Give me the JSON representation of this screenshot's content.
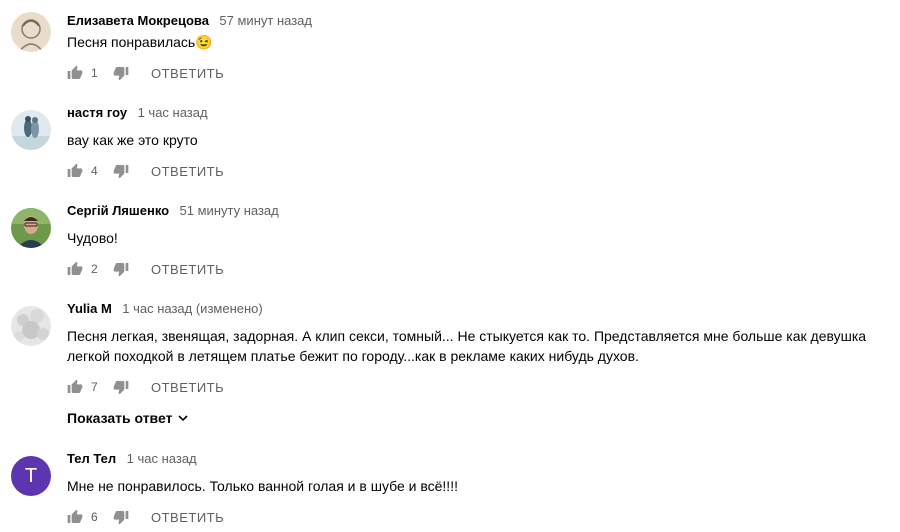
{
  "comments": [
    {
      "author": "Елизавета Мокрецова",
      "time": "57 минут назад",
      "text": "Песня понравилась😉",
      "likes": "1",
      "reply_label": "ОТВЕТИТЬ"
    },
    {
      "author": "настя гоу",
      "time": "1 час назад",
      "text": "вау как же это круто",
      "likes": "4",
      "reply_label": "ОТВЕТИТЬ"
    },
    {
      "author": "Сергій Ляшенко",
      "time": "51 минуту назад",
      "text": "Чудово!",
      "likes": "2",
      "reply_label": "ОТВЕТИТЬ"
    },
    {
      "author": "Yulia M",
      "time": "1 час назад (изменено)",
      "text": "Песня легкая, звенящая, задорная. А клип секси, томный... Не стыкуется как то. Представляется мне больше как девушка легкой походкой в летящем платье бежит по городу...как в рекламе каких нибудь духов.",
      "likes": "7",
      "reply_label": "ОТВЕТИТЬ",
      "show_replies": "Показать ответ"
    },
    {
      "author": "Тел Тел",
      "time": "1 час назад",
      "text": "Мне не понравилось. Только ванной голая и в шубе и всё!!!!",
      "likes": "6",
      "reply_label": "ОТВЕТИТЬ",
      "avatar_letter": "T",
      "avatar_color": "#5e35b1"
    }
  ]
}
